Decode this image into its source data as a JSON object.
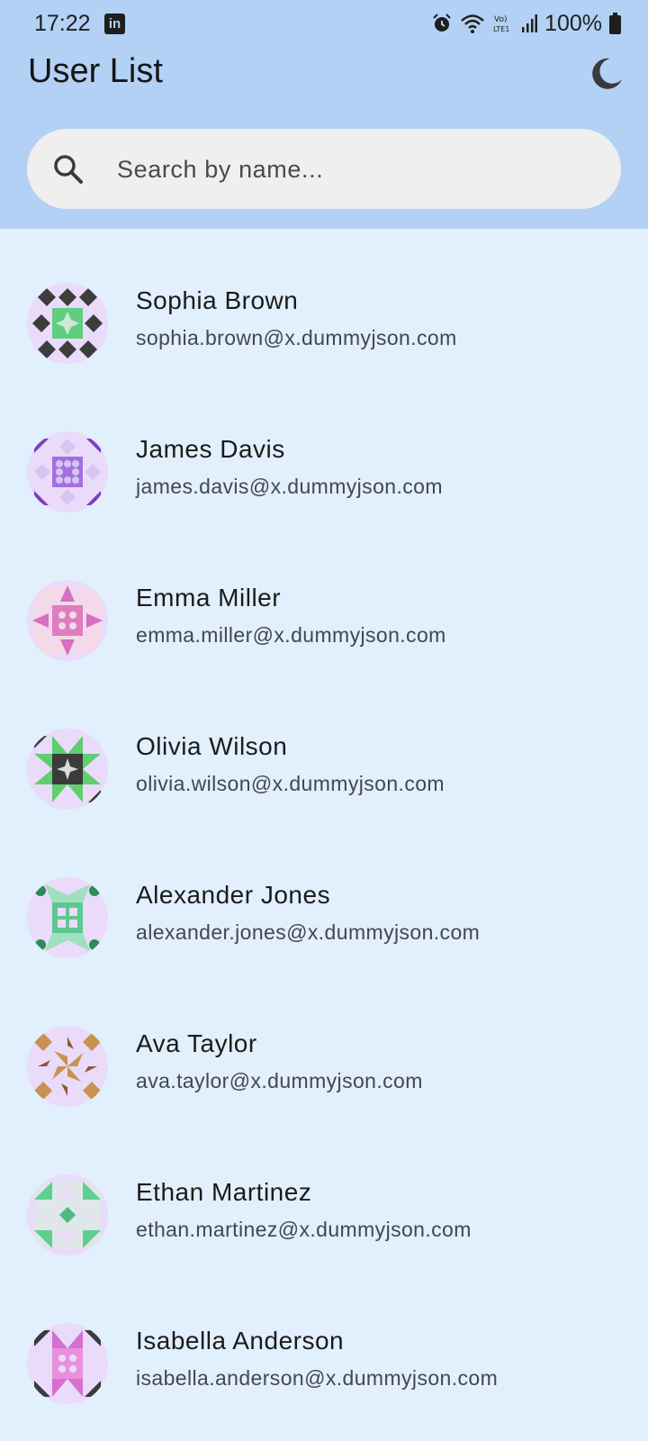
{
  "status_bar": {
    "time": "17:22",
    "battery": "100%",
    "icons": [
      "linkedin-icon",
      "alarm-icon",
      "wifi-icon",
      "volte-icon",
      "signal-icon",
      "battery-icon"
    ]
  },
  "app_bar": {
    "title": "User List",
    "theme_icon": "moon-icon"
  },
  "search": {
    "placeholder": "Search by name...",
    "value": ""
  },
  "colors": {
    "header_bg": "#b3d1f4",
    "page_bg": "#e2effc",
    "search_bg": "#efefef",
    "avatar_bg": "#eadbfa"
  },
  "users": [
    {
      "name": "Sophia Brown",
      "email": "sophia.brown@x.dummyjson.com",
      "avatar_colors": [
        "#3d3d3d",
        "#5fcf7d",
        "#cfe8d6"
      ]
    },
    {
      "name": "James Davis",
      "email": "james.davis@x.dummyjson.com",
      "avatar_colors": [
        "#7b3fbf",
        "#d7c4f2",
        "#a46fe0"
      ]
    },
    {
      "name": "Emma Miller",
      "email": "emma.miller@x.dummyjson.com",
      "avatar_colors": [
        "#d66fbf",
        "#f3d9ea",
        "#e07cc0"
      ]
    },
    {
      "name": "Olivia Wilson",
      "email": "olivia.wilson@x.dummyjson.com",
      "avatar_colors": [
        "#3b3b3b",
        "#5fcf6e",
        "#d9d9d9"
      ]
    },
    {
      "name": "Alexander Jones",
      "email": "alexander.jones@x.dummyjson.com",
      "avatar_colors": [
        "#2e8b57",
        "#9fe0bf",
        "#5cc98f"
      ]
    },
    {
      "name": "Ava Taylor",
      "email": "ava.taylor@x.dummyjson.com",
      "avatar_colors": [
        "#c8924f",
        "#f2dcc0",
        "#8a5a2b"
      ]
    },
    {
      "name": "Ethan Martinez",
      "email": "ethan.martinez@x.dummyjson.com",
      "avatar_colors": [
        "#5fcf8f",
        "#d8eddf",
        "#4dbb7d"
      ]
    },
    {
      "name": "Isabella Anderson",
      "email": "isabella.anderson@x.dummyjson.com",
      "avatar_colors": [
        "#3b3b3b",
        "#d66fcf",
        "#e890dd"
      ]
    }
  ]
}
